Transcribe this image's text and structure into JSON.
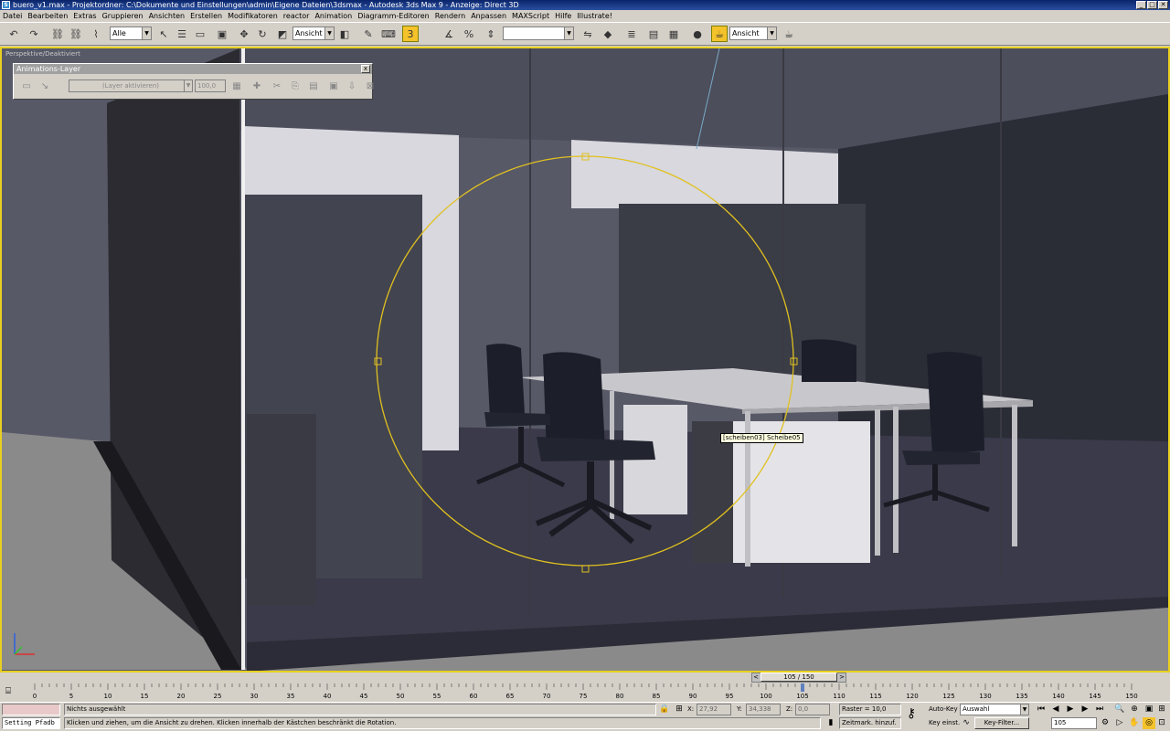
{
  "window": {
    "title": "buero_v1.max    - Projektordner: C:\\Dokumente und Einstellungen\\admin\\Eigene Dateien\\3dsmax     -     Autodesk 3ds Max 9     -   Anzeige: Direct 3D",
    "controls": [
      "_",
      "□",
      "✕"
    ]
  },
  "menu": [
    "Datei",
    "Bearbeiten",
    "Extras",
    "Gruppieren",
    "Ansichten",
    "Erstellen",
    "Modifikatoren",
    "reactor",
    "Animation",
    "Diagramm-Editoren",
    "Rendern",
    "Anpassen",
    "MAXScript",
    "Hilfe",
    "Illustrate!"
  ],
  "toolbar": {
    "selection_filter": "Alle",
    "ref_coord": "Ansicht",
    "named_selection": "",
    "render_view": "Ansicht"
  },
  "viewport": {
    "label": "Perspektive/Deaktiviert",
    "object_tooltip": "[scheiben03] Scheibe05",
    "border_color": "#e8d020",
    "gizmo_color": "#e0c020"
  },
  "anim_layer_dialog": {
    "title": "Animations-Layer",
    "close": "x",
    "layer_combo": "(Layer aktivieren)",
    "weight": "100,0"
  },
  "time_slider": {
    "frame_display": "105 / 150",
    "prev": "<",
    "next": ">"
  },
  "trackbar": {
    "ticks": [
      "0",
      "5",
      "10",
      "15",
      "20",
      "25",
      "30",
      "35",
      "40",
      "45",
      "50",
      "55",
      "60",
      "65",
      "70",
      "75",
      "80",
      "85",
      "90",
      "95",
      "100",
      "105",
      "110",
      "115",
      "120",
      "125",
      "130",
      "135",
      "140",
      "145",
      "150"
    ],
    "current_frame": 105,
    "total_frames": 150
  },
  "status": {
    "maxscript_listener": "",
    "script_line": "Setting Pfadb",
    "selection_info": "Nichts ausgewählt",
    "prompt": "Klicken und ziehen, um die Ansicht zu drehen. Klicken innerhalb der Kästchen beschränkt die Rotation.",
    "x_label": "X:",
    "x_value": "27,92",
    "y_label": "Y:",
    "y_value": "34,338",
    "z_label": "Z:",
    "z_value": "0,0",
    "grid": "Raster = 10,0",
    "add_time_tag": "Zeitmark. hinzuf.",
    "auto_key": "Auto-Key",
    "set_key": "Key einst.",
    "key_mode": "Auswahl",
    "key_filters": "Key-Filter...",
    "current_frame": "105"
  }
}
